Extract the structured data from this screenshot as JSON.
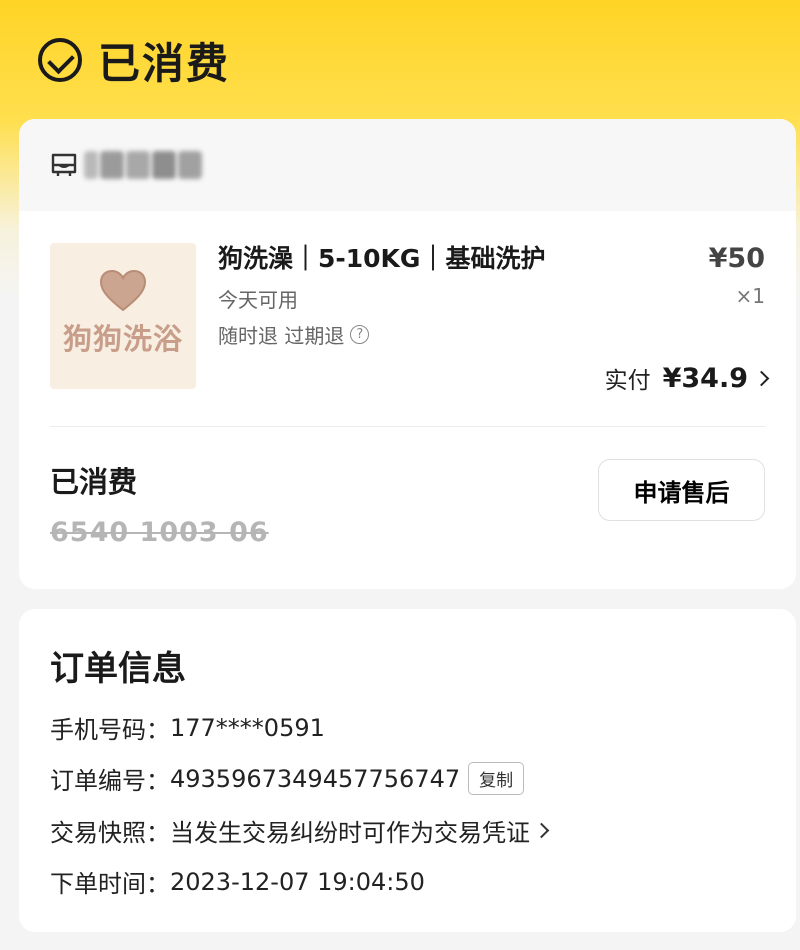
{
  "header": {
    "title": "已消费"
  },
  "shop": {
    "name_blurred": true
  },
  "product": {
    "image_text": "狗狗洗浴",
    "name": "狗洗澡｜5-10KG｜基础洗护",
    "availability": "今天可用",
    "refund_policy": "随时退 过期退",
    "help_icon": "?",
    "price": "¥50",
    "quantity": "×1",
    "paid_label": "实付",
    "paid_value": "¥34.9"
  },
  "voucher": {
    "status": "已消费",
    "code": "6540 1003 06",
    "after_sale_button": "申请售后"
  },
  "order_info": {
    "title": "订单信息",
    "phone_label": "手机号码：",
    "phone_value": "177****0591",
    "order_no_label": "订单编号：",
    "order_no_value": "4935967349457756747",
    "copy_button": "复制",
    "snapshot_label": "交易快照：",
    "snapshot_value": "当发生交易纠纷时可作为交易凭证",
    "time_label": "下单时间：",
    "time_value": "2023-12-07 19:04:50"
  },
  "colors": {
    "header_yellow": "#ffd426",
    "heart": "#c9a58f",
    "image_bg": "#f8efe2"
  },
  "icons": [
    "check-circle-icon",
    "store-icon",
    "heart-icon",
    "help-icon",
    "chevron-right-icon"
  ]
}
